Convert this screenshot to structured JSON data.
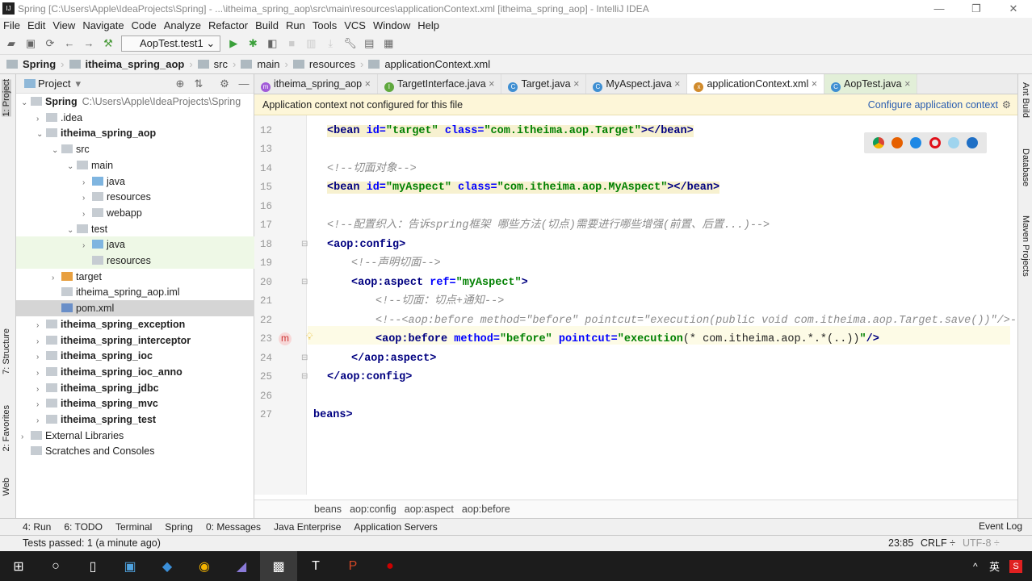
{
  "window": {
    "title": "Spring [C:\\Users\\Apple\\IdeaProjects\\Spring] - ...\\itheima_spring_aop\\src\\main\\resources\\applicationContext.xml [itheima_spring_aop] - IntelliJ IDEA",
    "logo": "IJ"
  },
  "menu": [
    "File",
    "Edit",
    "View",
    "Navigate",
    "Code",
    "Analyze",
    "Refactor",
    "Build",
    "Run",
    "Tools",
    "VCS",
    "Window",
    "Help"
  ],
  "toolbar": {
    "run_config": "AopTest.test1"
  },
  "breadcrumbs": [
    "Spring",
    "itheima_spring_aop",
    "src",
    "main",
    "resources",
    "applicationContext.xml"
  ],
  "left_stripe": [
    "1: Project",
    "7: Structure",
    "2: Favorites",
    "Web"
  ],
  "project": {
    "title": "Project",
    "rows": [
      {
        "label": "Spring",
        "extra": "C:\\Users\\Apple\\IdeaProjects\\Spring",
        "lvl": 0,
        "exp": "open",
        "bold": true
      },
      {
        "label": ".idea",
        "lvl": 1,
        "exp": "closed"
      },
      {
        "label": "itheima_spring_aop",
        "lvl": 1,
        "exp": "open",
        "bold": true
      },
      {
        "label": "src",
        "lvl": 2,
        "exp": "open"
      },
      {
        "label": "main",
        "lvl": 3,
        "exp": "open"
      },
      {
        "label": "java",
        "lvl": 4,
        "exp": "closed"
      },
      {
        "label": "resources",
        "lvl": 4,
        "exp": "closed"
      },
      {
        "label": "webapp",
        "lvl": 4,
        "exp": "closed"
      },
      {
        "label": "test",
        "lvl": 3,
        "exp": "open"
      },
      {
        "label": "java",
        "lvl": 4,
        "exp": "closed",
        "green": true
      },
      {
        "label": "resources",
        "lvl": 4,
        "exp": "none",
        "green": true
      },
      {
        "label": "target",
        "lvl": 2,
        "exp": "closed"
      },
      {
        "label": "itheima_spring_aop.iml",
        "lvl": 2,
        "exp": "none"
      },
      {
        "label": "pom.xml",
        "lvl": 2,
        "exp": "none",
        "selected": true
      },
      {
        "label": "itheima_spring_exception",
        "lvl": 1,
        "exp": "closed",
        "bold": true
      },
      {
        "label": "itheima_spring_interceptor",
        "lvl": 1,
        "exp": "closed",
        "bold": true
      },
      {
        "label": "itheima_spring_ioc",
        "lvl": 1,
        "exp": "closed",
        "bold": true
      },
      {
        "label": "itheima_spring_ioc_anno",
        "lvl": 1,
        "exp": "closed",
        "bold": true
      },
      {
        "label": "itheima_spring_jdbc",
        "lvl": 1,
        "exp": "closed",
        "bold": true
      },
      {
        "label": "itheima_spring_mvc",
        "lvl": 1,
        "exp": "closed",
        "bold": true
      },
      {
        "label": "itheima_spring_test",
        "lvl": 1,
        "exp": "closed",
        "bold": true
      },
      {
        "label": "External Libraries",
        "lvl": 0,
        "exp": "closed"
      },
      {
        "label": "Scratches and Consoles",
        "lvl": 0,
        "exp": "none"
      }
    ]
  },
  "tabs": [
    {
      "label": "itheima_spring_aop",
      "icon": "m",
      "color": "#a15bd8"
    },
    {
      "label": "TargetInterface.java",
      "icon": "I",
      "color": "#5fa83e"
    },
    {
      "label": "Target.java",
      "icon": "C",
      "color": "#3f8fd2"
    },
    {
      "label": "MyAspect.java",
      "icon": "C",
      "color": "#3f8fd2"
    },
    {
      "label": "applicationContext.xml",
      "icon": "x",
      "color": "#d18b2c",
      "active": true
    },
    {
      "label": "AopTest.java",
      "icon": "C",
      "color": "#3f8fd2",
      "green": true
    }
  ],
  "banner": {
    "text": "Application context not configured for this file",
    "link": "Configure application context"
  },
  "code": [
    {
      "n": "12",
      "i": 1,
      "hl": true,
      "t": [
        [
          "tag",
          "<bean "
        ],
        [
          "attr",
          "id="
        ],
        [
          "val",
          "\"target\" "
        ],
        [
          "attr",
          "class="
        ],
        [
          "val",
          "\"com.itheima.aop.Target\""
        ],
        [
          "tag",
          "></bean>"
        ]
      ]
    },
    {
      "n": "13",
      "i": 0,
      "t": []
    },
    {
      "n": "14",
      "i": 1,
      "t": [
        [
          "cm",
          "<!--切面对象-->"
        ]
      ]
    },
    {
      "n": "15",
      "i": 1,
      "hl": true,
      "t": [
        [
          "tag",
          "<bean "
        ],
        [
          "attr",
          "id="
        ],
        [
          "val",
          "\"myAspect\" "
        ],
        [
          "attr",
          "class="
        ],
        [
          "val",
          "\"com.itheima.aop.MyAspect\""
        ],
        [
          "tag",
          "></bean>"
        ]
      ]
    },
    {
      "n": "16",
      "i": 0,
      "t": []
    },
    {
      "n": "17",
      "i": 1,
      "t": [
        [
          "cm",
          "<!--配置织入：告诉spring框架 哪些方法(切点)需要进行哪些增强(前置、后置...)-->"
        ]
      ]
    },
    {
      "n": "18",
      "i": 1,
      "t": [
        [
          "tag",
          "<aop:config>"
        ]
      ]
    },
    {
      "n": "19",
      "i": 2,
      "t": [
        [
          "cm",
          "<!--声明切面-->"
        ]
      ]
    },
    {
      "n": "20",
      "i": 2,
      "t": [
        [
          "tag",
          "<aop:aspect "
        ],
        [
          "attr",
          "ref="
        ],
        [
          "val",
          "\"myAspect\""
        ],
        [
          "tag",
          ">"
        ]
      ]
    },
    {
      "n": "21",
      "i": 3,
      "t": [
        [
          "cm",
          "<!--切面：切点+通知-->"
        ]
      ]
    },
    {
      "n": "22",
      "i": 3,
      "t": [
        [
          "cm",
          "<!--<aop:before method=\"before\" pointcut=\"execution(public void com.itheima.aop.Target.save())\"/>-->"
        ]
      ]
    },
    {
      "n": "23",
      "i": 3,
      "cur": true,
      "t": [
        [
          "tag",
          "<aop:before "
        ],
        [
          "attr",
          "method="
        ],
        [
          "val",
          "\"before\" "
        ],
        [
          "attr",
          "pointcut="
        ],
        [
          "val",
          "\"execution"
        ],
        [
          "",
          "(* com.itheima.aop.*.*(..))"
        ],
        [
          "val",
          "\""
        ],
        [
          "tag",
          "/>"
        ]
      ]
    },
    {
      "n": "24",
      "i": 2,
      "t": [
        [
          "tag",
          "</aop:aspect>"
        ]
      ]
    },
    {
      "n": "25",
      "i": 1,
      "t": [
        [
          "tag",
          "</aop:config>"
        ]
      ]
    },
    {
      "n": "26",
      "i": 0,
      "t": []
    },
    {
      "n": "27",
      "i": 0,
      "t": [
        [
          "tag",
          "beans>"
        ]
      ]
    }
  ],
  "editor_breadcrumbs": [
    "beans",
    "aop:config",
    "aop:aspect",
    "aop:before"
  ],
  "right_stripe": [
    "Ant Build",
    "Database",
    "Maven Projects"
  ],
  "bottom_tabs": [
    "4: Run",
    "6: TODO",
    "Terminal",
    "Spring",
    "0: Messages",
    "Java Enterprise",
    "Application Servers"
  ],
  "event_log": "Event Log",
  "status": {
    "message": "Tests passed: 1 (a minute ago)",
    "position": "23:85",
    "line_sep": "CRLF ÷",
    "encoding": "UTF-8 ÷"
  },
  "taskbar": {
    "ime": "英"
  }
}
